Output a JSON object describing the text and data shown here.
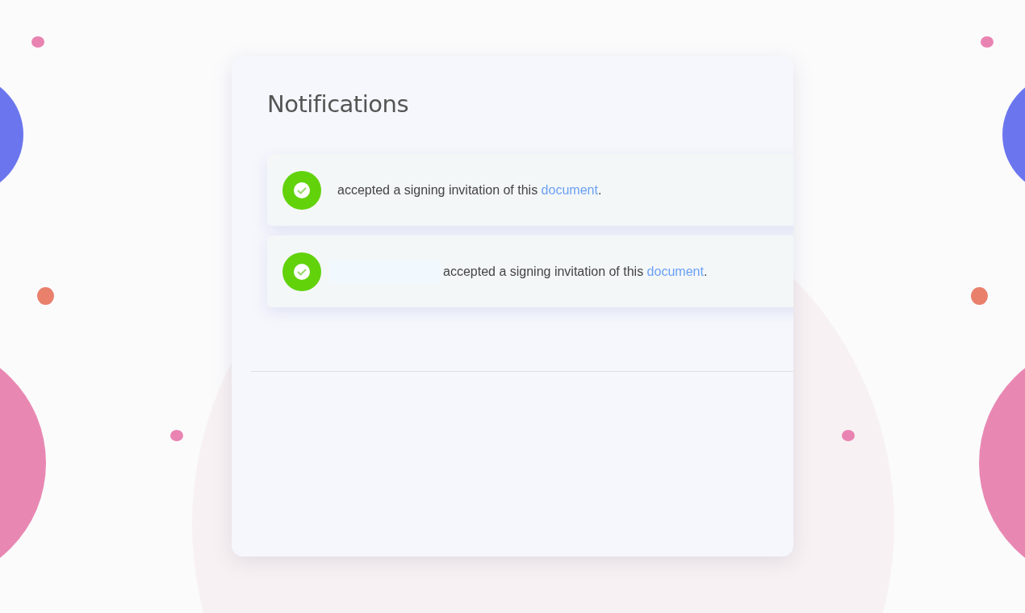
{
  "panel": {
    "title": "Notifications"
  },
  "notifications": [
    {
      "kind": "success",
      "redacted_name": false,
      "text": "accepted a signing invitation of this",
      "link": "document",
      "after": "."
    },
    {
      "kind": "success",
      "redacted_name": true,
      "text": "accepted a signing invitation of this",
      "link": "document",
      "after": "."
    }
  ]
}
